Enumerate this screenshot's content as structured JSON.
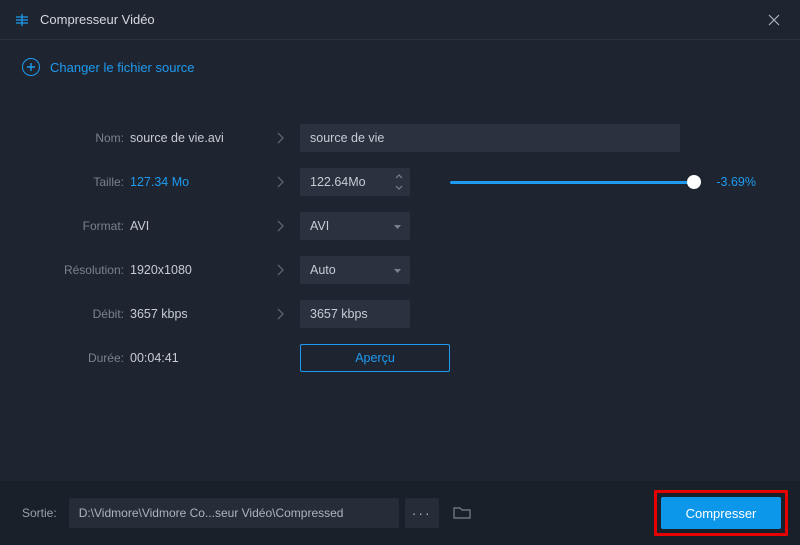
{
  "window": {
    "title": "Compresseur Vidéo"
  },
  "change_source": {
    "label": "Changer le fichier source"
  },
  "form": {
    "nom": {
      "label": "Nom:",
      "value": "source de vie.avi",
      "input": "source de vie"
    },
    "taille": {
      "label": "Taille:",
      "value": "127.34 Mo",
      "input": "122.64Mo",
      "percent": "-3.69%"
    },
    "format": {
      "label": "Format:",
      "value": "AVI",
      "select": "AVI"
    },
    "resolution": {
      "label": "Résolution:",
      "value": "1920x1080",
      "select": "Auto"
    },
    "debit": {
      "label": "Débit:",
      "value": "3657 kbps",
      "input": "3657 kbps"
    },
    "duree": {
      "label": "Durée:",
      "value": "00:04:41"
    },
    "preview": "Aperçu"
  },
  "footer": {
    "out_label": "Sortie:",
    "path": "D:\\Vidmore\\Vidmore Co...seur Vidéo\\Compressed",
    "compress": "Compresser"
  }
}
